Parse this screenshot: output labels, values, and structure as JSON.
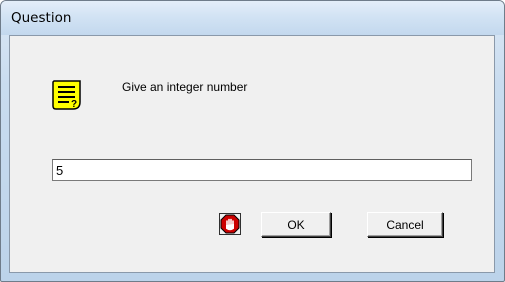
{
  "window": {
    "title": "Question"
  },
  "dialog": {
    "prompt": "Give an integer number",
    "input_value": "5",
    "ok_label": "OK",
    "cancel_label": "Cancel"
  },
  "icons": {
    "question": "question-note-icon",
    "stop": "stop-hand-icon"
  },
  "colors": {
    "question_icon_fill": "#ffff00",
    "stop_icon_fill": "#cc0000"
  }
}
